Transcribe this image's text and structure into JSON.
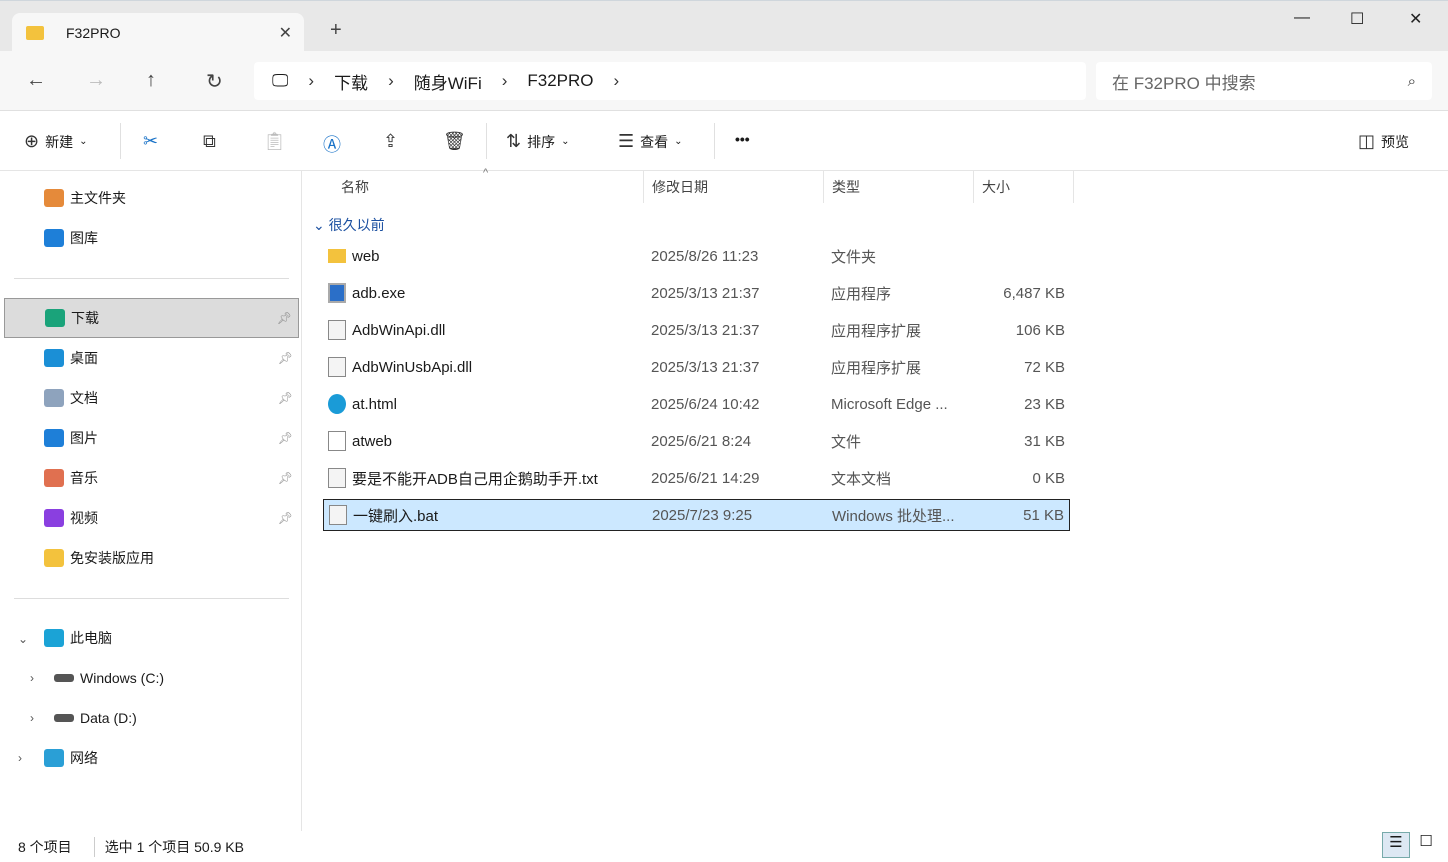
{
  "tab": {
    "title": "F32PRO"
  },
  "breadcrumb": [
    "下载",
    "随身WiFi",
    "F32PRO"
  ],
  "search": {
    "placeholder": "在 F32PRO 中搜索"
  },
  "toolbar": {
    "new": "新建",
    "sort": "排序",
    "view": "查看",
    "more": "•••",
    "preview": "预览"
  },
  "sidebar": {
    "home": "主文件夹",
    "gallery": "图库",
    "quick": [
      {
        "label": "下载",
        "color": "#1aa37a",
        "pinned": true
      },
      {
        "label": "桌面",
        "color": "#1b8fd6",
        "pinned": true
      },
      {
        "label": "文档",
        "color": "#8ea3bd",
        "pinned": true
      },
      {
        "label": "图片",
        "color": "#1e7fd8",
        "pinned": true
      },
      {
        "label": "音乐",
        "color": "#e07050",
        "pinned": true
      },
      {
        "label": "视频",
        "color": "#8a3fe0",
        "pinned": true
      },
      {
        "label": "免安装版应用",
        "color": "#f3c23d",
        "pinned": false
      }
    ],
    "pc": "此电脑",
    "drives": [
      "Windows  (C:)",
      "Data (D:)"
    ],
    "network": "网络"
  },
  "columns": {
    "name": "名称",
    "date": "修改日期",
    "type": "类型",
    "size": "大小"
  },
  "group": "很久以前",
  "files": [
    {
      "name": "web",
      "date": "2025/8/26 11:23",
      "type": "文件夹",
      "size": "",
      "icon": "folder"
    },
    {
      "name": "adb.exe",
      "date": "2025/3/13 21:37",
      "type": "应用程序",
      "size": "6,487 KB",
      "icon": "exe"
    },
    {
      "name": "AdbWinApi.dll",
      "date": "2025/3/13 21:37",
      "type": "应用程序扩展",
      "size": "106 KB",
      "icon": "dll"
    },
    {
      "name": "AdbWinUsbApi.dll",
      "date": "2025/3/13 21:37",
      "type": "应用程序扩展",
      "size": "72 KB",
      "icon": "dll"
    },
    {
      "name": "at.html",
      "date": "2025/6/24 10:42",
      "type": "Microsoft Edge ...",
      "size": "23 KB",
      "icon": "edge"
    },
    {
      "name": "atweb",
      "date": "2025/6/21 8:24",
      "type": "文件",
      "size": "31 KB",
      "icon": "file"
    },
    {
      "name": "要是不能开ADB自己用企鹅助手开.txt",
      "date": "2025/6/21 14:29",
      "type": "文本文档",
      "size": "0 KB",
      "icon": "txt"
    },
    {
      "name": "一键刷入.bat",
      "date": "2025/7/23 9:25",
      "type": "Windows 批处理...",
      "size": "51 KB",
      "icon": "bat",
      "selected": true
    }
  ],
  "status": {
    "count": "8 个项目",
    "selection": "选中 1 个项目  50.9 KB"
  }
}
